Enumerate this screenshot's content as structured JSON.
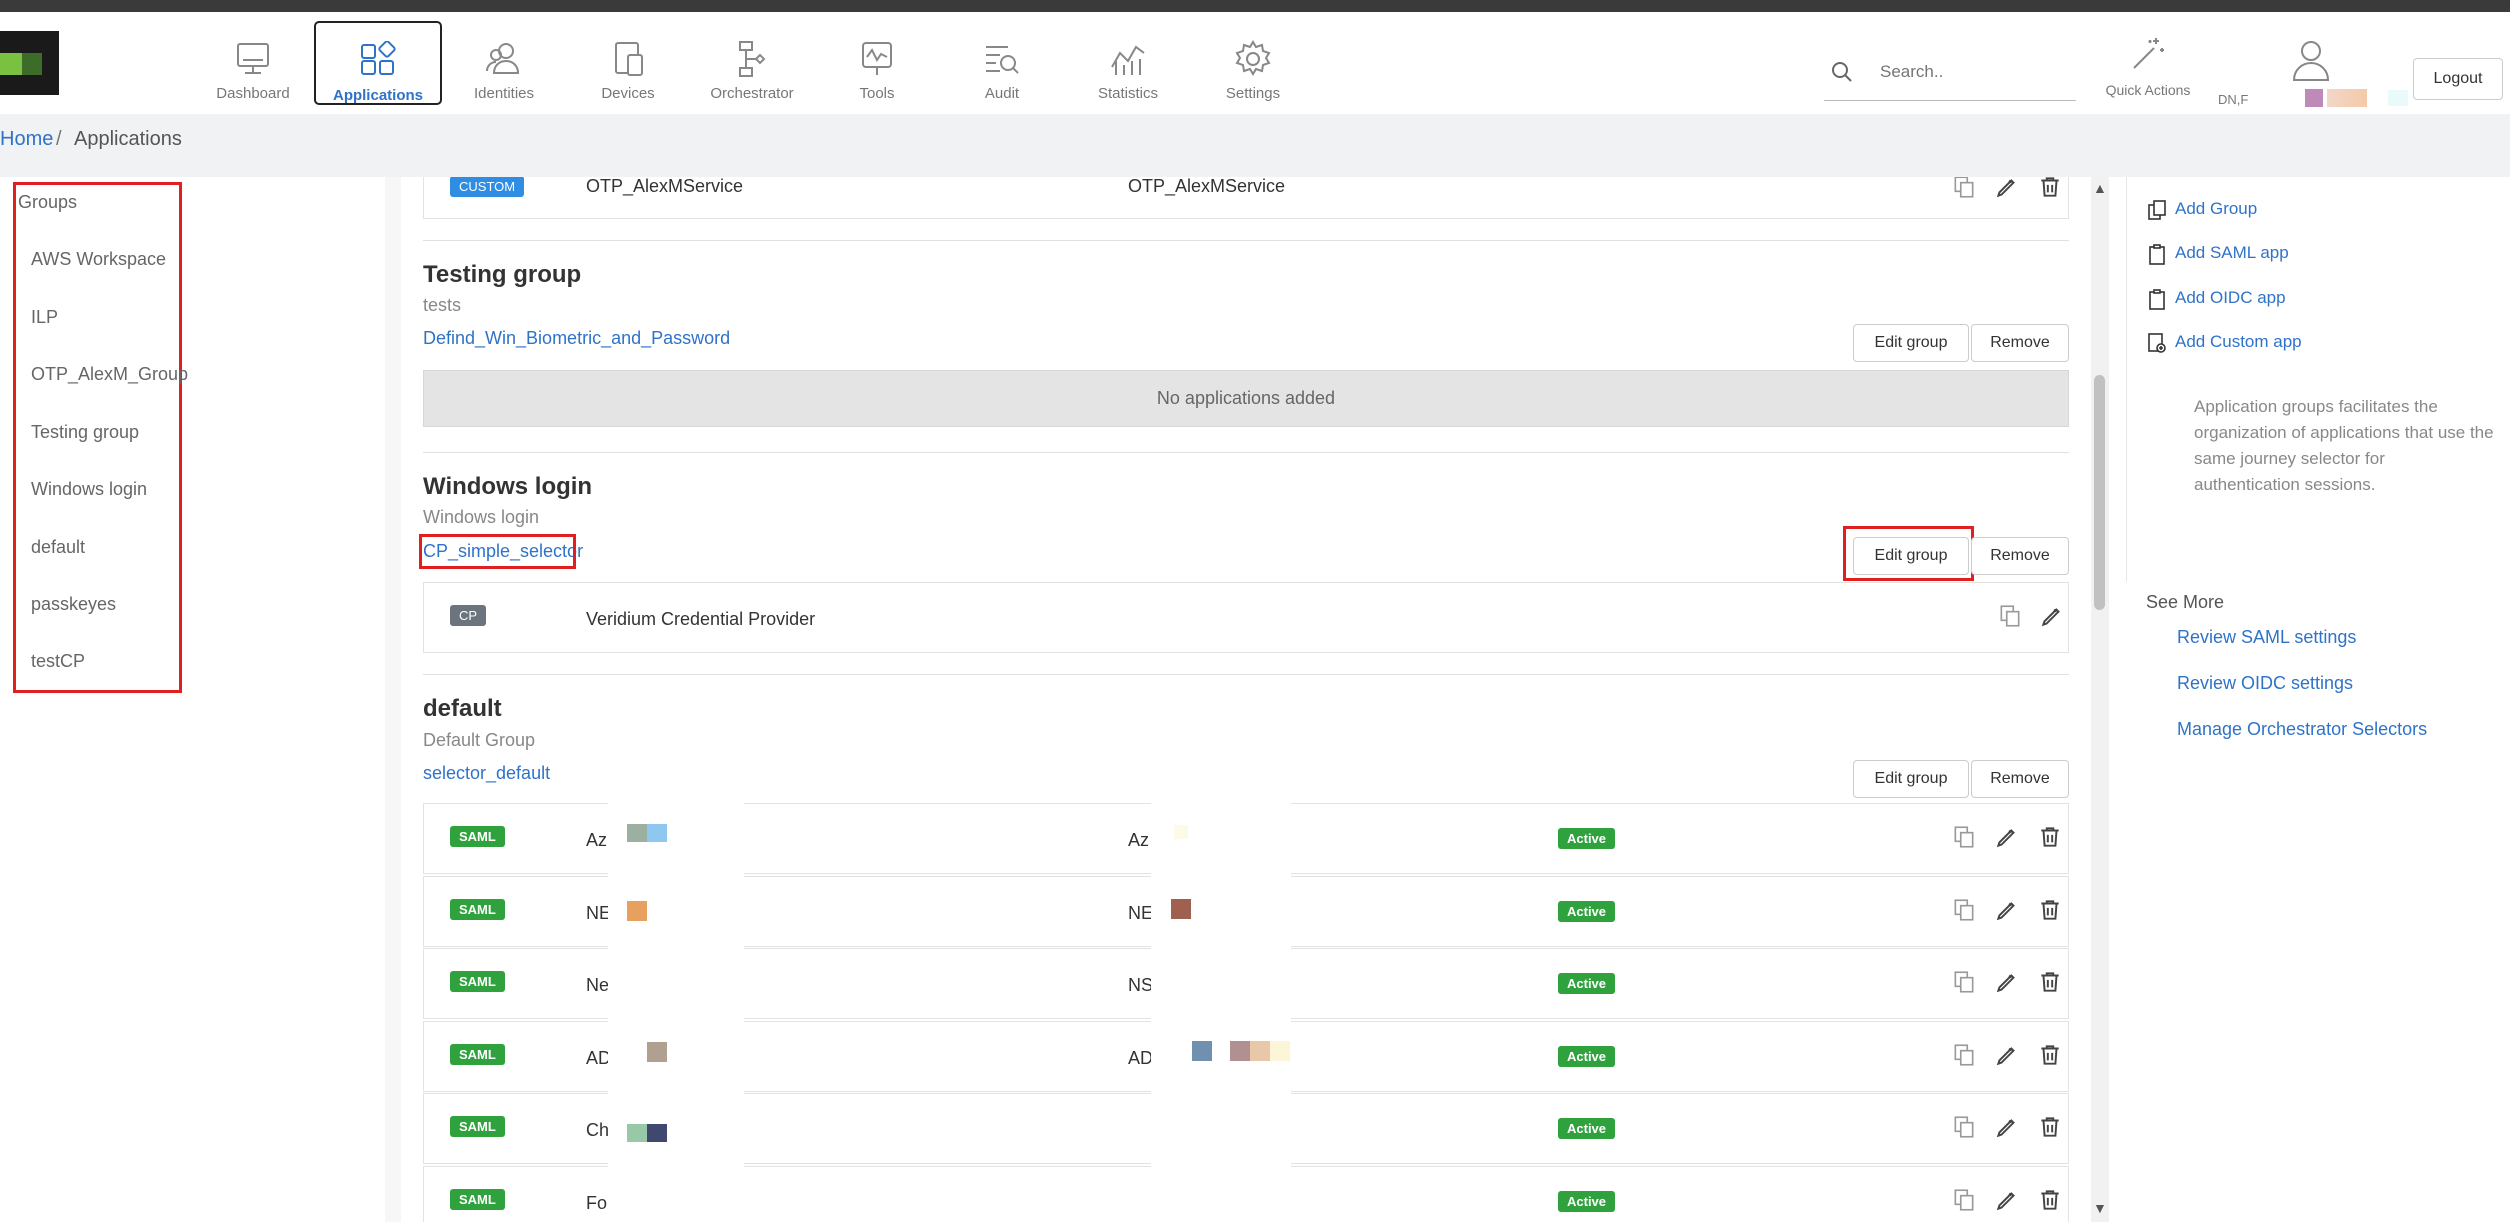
{
  "nav": {
    "items": [
      {
        "label": "Dashboard",
        "icon": "monitor-icon"
      },
      {
        "label": "Applications",
        "icon": "grid-icon",
        "active": true
      },
      {
        "label": "Identities",
        "icon": "users-icon"
      },
      {
        "label": "Devices",
        "icon": "devices-icon"
      },
      {
        "label": "Orchestrator",
        "icon": "flow-icon"
      },
      {
        "label": "Tools",
        "icon": "tools-icon"
      },
      {
        "label": "Audit",
        "icon": "audit-icon"
      },
      {
        "label": "Statistics",
        "icon": "statistics-icon"
      },
      {
        "label": "Settings",
        "icon": "gear-icon"
      }
    ],
    "active_color": "#2f73c9"
  },
  "header": {
    "search_placeholder": "Search..",
    "quick_actions_label": "Quick Actions",
    "user_short": "DN,F",
    "logout_label": "Logout"
  },
  "breadcrumb": {
    "home": "Home",
    "separator": "/",
    "current": "Applications"
  },
  "sidebar": {
    "title": "Groups",
    "items": [
      "AWS Workspace",
      "ILP",
      "OTP_AlexM_Group",
      "Testing group",
      "Windows login",
      "default",
      "passkeyes",
      "testCP"
    ]
  },
  "main": {
    "top_row": {
      "badge": "CUSTOM",
      "name": "OTP_AlexMService",
      "id": "OTP_AlexMService"
    },
    "groups": [
      {
        "title": "Testing group",
        "description": "tests",
        "selector": "Defind_Win_Biometric_and_Password",
        "edit_label": "Edit group",
        "remove_label": "Remove",
        "empty_text": "No applications added"
      },
      {
        "title": "Windows login",
        "description": "Windows login",
        "selector": "CP_simple_selector",
        "edit_label": "Edit group",
        "remove_label": "Remove",
        "apps": [
          {
            "badge": "CP",
            "name": "Veridium Credential Provider"
          }
        ]
      },
      {
        "title": "default",
        "description": "Default Group",
        "selector": "selector_default",
        "edit_label": "Edit group",
        "remove_label": "Remove",
        "apps": [
          {
            "badge": "SAML",
            "name": "Azı",
            "id": "Az",
            "status": "Active"
          },
          {
            "badge": "SAML",
            "name": "NE",
            "id": "NE",
            "status": "Active"
          },
          {
            "badge": "SAML",
            "name": "Ne",
            "id": "NS",
            "status": "Active"
          },
          {
            "badge": "SAML",
            "name": "AD",
            "id": "AD",
            "status": "Active"
          },
          {
            "badge": "SAML",
            "name": "Ch",
            "id": "",
            "status": "Active"
          },
          {
            "badge": "SAML",
            "name": "For",
            "id": "",
            "status": "Active"
          }
        ]
      }
    ]
  },
  "quick_actions": {
    "items": [
      "Add Group",
      "Add SAML app",
      "Add OIDC app",
      "Add Custom app"
    ],
    "info": "Application groups facilitates the organization of applications that use the same journey selector for authentication sessions."
  },
  "see_more": {
    "title": "See More",
    "links": [
      "Review SAML settings",
      "Review OIDC settings",
      "Manage Orchestrator Selectors"
    ]
  }
}
